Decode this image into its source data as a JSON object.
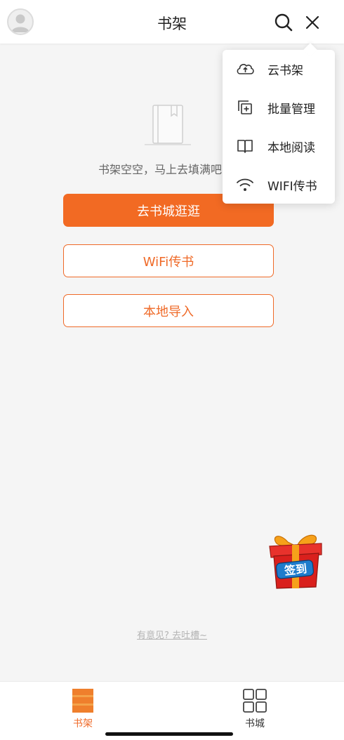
{
  "header": {
    "title": "书架",
    "avatar_icon": "user-avatar-icon",
    "search_icon": "search-icon",
    "close_icon": "close-icon"
  },
  "empty_state": {
    "icon": "empty-bookshelf-icon",
    "message": "书架空空，马上去填满吧",
    "primary_button": "去书城逛逛",
    "wifi_button": "WiFi传书",
    "local_button": "本地导入"
  },
  "menu": {
    "items": [
      {
        "label": "云书架",
        "icon": "cloud-upload-icon"
      },
      {
        "label": "批量管理",
        "icon": "batch-manage-icon"
      },
      {
        "label": "本地阅读",
        "icon": "open-book-icon"
      },
      {
        "label": "WIFI传书",
        "icon": "wifi-icon"
      }
    ]
  },
  "gift": {
    "label": "签到",
    "icon": "gift-box-icon"
  },
  "feedback": {
    "text": "有意见? 去吐槽~"
  },
  "tabbar": {
    "items": [
      {
        "label": "书架",
        "icon": "bookshelf-icon",
        "active": true
      },
      {
        "label": "书城",
        "icon": "grid-icon",
        "active": false
      }
    ]
  },
  "colors": {
    "accent": "#f26a23",
    "background": "#f5f5f5",
    "text": "#333333"
  }
}
